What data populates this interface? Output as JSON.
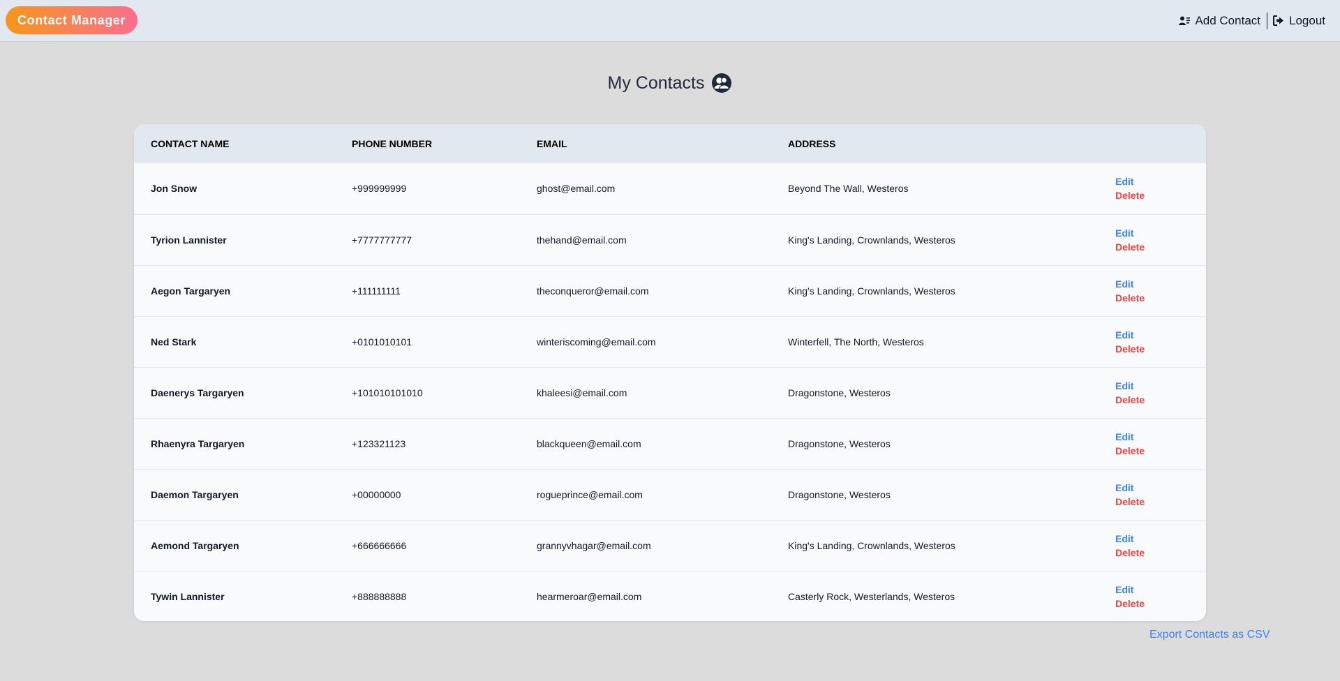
{
  "header": {
    "brand": "Contact Manager",
    "add_contact": "Add Contact",
    "logout": "Logout"
  },
  "page": {
    "title": "My Contacts"
  },
  "table": {
    "columns": [
      "CONTACT NAME",
      "PHONE NUMBER",
      "EMAIL",
      "ADDRESS"
    ],
    "rows": [
      {
        "name": "Jon Snow",
        "phone": "+999999999",
        "email": "ghost@email.com",
        "address": "Beyond The Wall, Westeros"
      },
      {
        "name": "Tyrion Lannister",
        "phone": "+7777777777",
        "email": "thehand@email.com",
        "address": "King's Landing, Crownlands, Westeros"
      },
      {
        "name": "Aegon Targaryen",
        "phone": "+111111111",
        "email": "theconqueror@email.com",
        "address": "King's Landing, Crownlands, Westeros"
      },
      {
        "name": "Ned Stark",
        "phone": "+0101010101",
        "email": "winteriscoming@email.com",
        "address": "Winterfell, The North, Westeros"
      },
      {
        "name": "Daenerys Targaryen",
        "phone": "+101010101010",
        "email": "khaleesi@email.com",
        "address": "Dragonstone, Westeros"
      },
      {
        "name": "Rhaenyra Targaryen",
        "phone": "+123321123",
        "email": "blackqueen@email.com",
        "address": "Dragonstone, Westeros"
      },
      {
        "name": "Daemon Targaryen",
        "phone": "+00000000",
        "email": "rogueprince@email.com",
        "address": "Dragonstone, Westeros"
      },
      {
        "name": "Aemond Targaryen",
        "phone": "+666666666",
        "email": "grannyvhagar@email.com",
        "address": "King's Landing, Crownlands, Westeros"
      },
      {
        "name": "Tywin Lannister",
        "phone": "+888888888",
        "email": "hearmeroar@email.com",
        "address": "Casterly Rock, Westerlands, Westeros"
      }
    ],
    "edit_label": "Edit",
    "delete_label": "Delete"
  },
  "footer": {
    "export_label": "Export Contacts as CSV"
  },
  "icons": {
    "add_contact": "user-list-icon",
    "logout": "sign-out-icon",
    "title": "users-circle-icon"
  },
  "colors": {
    "brand_gradient_start": "#f7961c",
    "brand_gradient_end": "#f96f8f",
    "link_blue": "#3b82f6",
    "delete_red": "#ef4444",
    "header_bg": "#e2e8f0",
    "page_bg": "#dcdcdc"
  }
}
